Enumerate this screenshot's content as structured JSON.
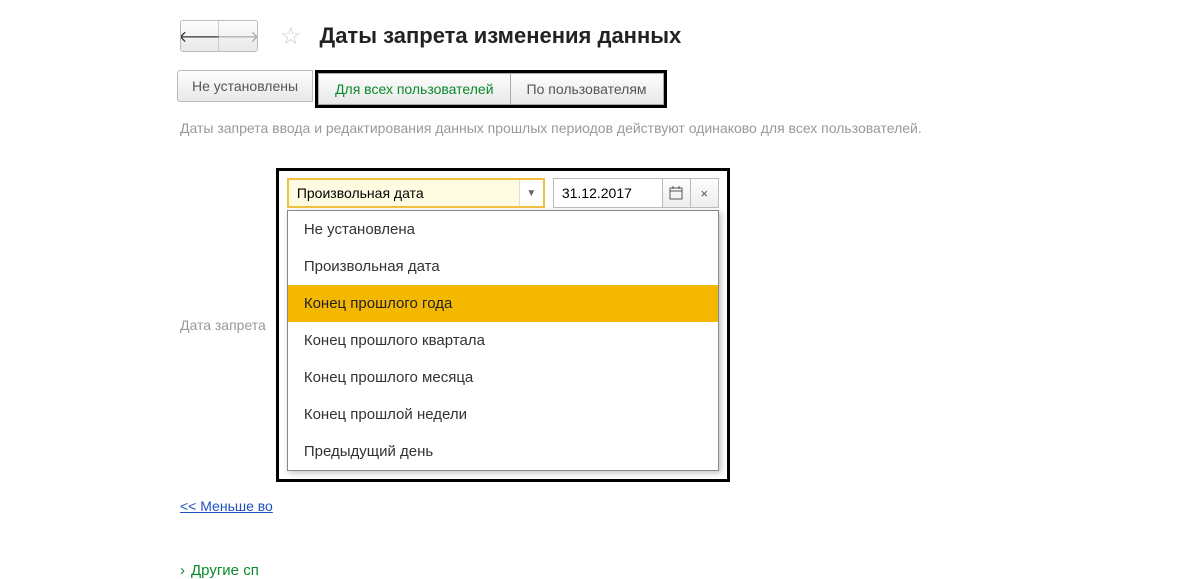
{
  "header": {
    "title": "Даты запрета изменения данных"
  },
  "tabs": {
    "out": "Не установлены",
    "all_users": "Для всех пользователей",
    "by_users": "По пользователям"
  },
  "info_text": "Даты запрета ввода и редактирования данных прошлых периодов действуют одинаково для всех пользователей.",
  "field": {
    "label": "Дата запрета",
    "combo_value": "Произвольная дата",
    "date_value": "31.12.2017"
  },
  "link_less": "<< Меньше во",
  "other_ways": "Другие сп",
  "dropdown": {
    "items": [
      "Не установлена",
      "Произвольная дата",
      "Конец прошлого года",
      "Конец прошлого квартала",
      "Конец прошлого месяца",
      "Конец прошлой недели",
      "Предыдущий день"
    ],
    "highlighted_index": 2
  }
}
